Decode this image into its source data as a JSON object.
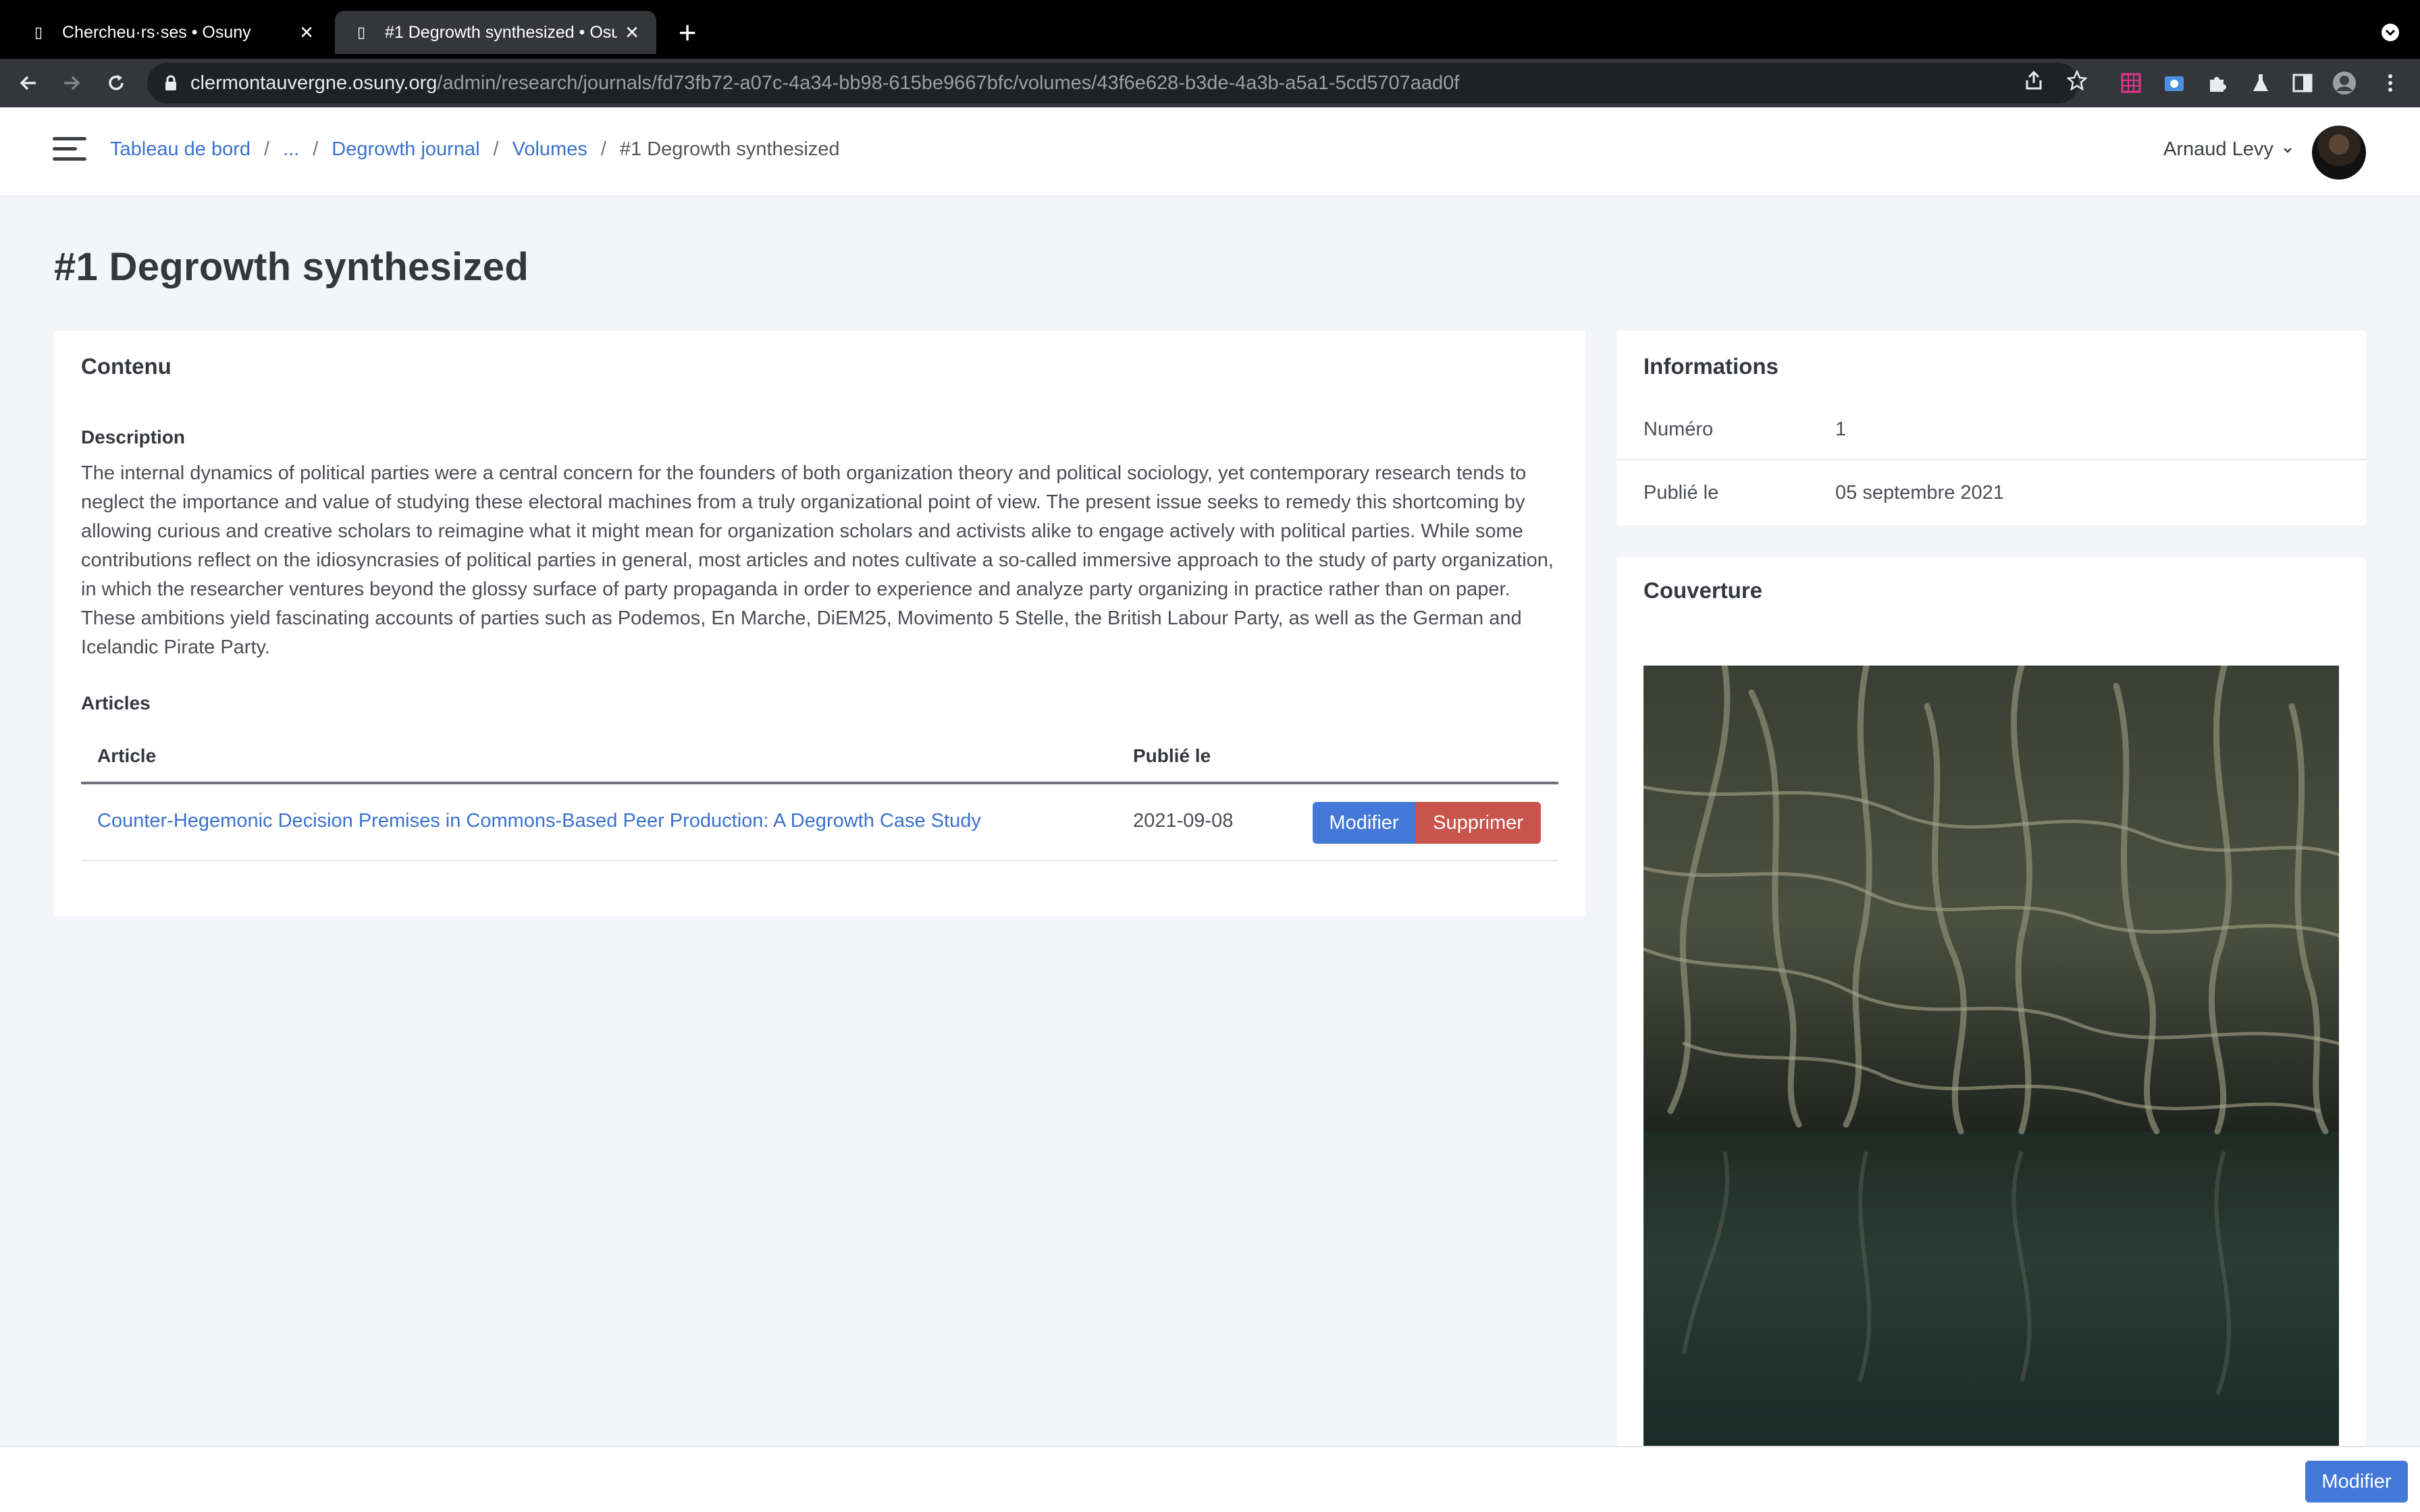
{
  "browser": {
    "tabs": [
      {
        "title": "Chercheu·rs·ses • Osuny",
        "active": false
      },
      {
        "title": "#1 Degrowth synthesized • Osuny",
        "active": true
      }
    ],
    "url_host": "clermontauvergne.osuny.org",
    "url_path": "/admin/research/journals/fd73fb72-a07c-4a34-bb98-615be9667bfc/volumes/43f6e628-b3de-4a3b-a5a1-5cd5707aad0f"
  },
  "header": {
    "breadcrumb": {
      "home": "Tableau de bord",
      "ellipsis": "...",
      "journal": "Degrowth journal",
      "volumes": "Volumes",
      "current": "#1 Degrowth synthesized"
    },
    "user_name": "Arnaud Levy"
  },
  "page": {
    "title": "#1 Degrowth synthesized"
  },
  "content": {
    "card_title": "Contenu",
    "description_label": "Description",
    "description": "The internal dynamics of political parties were a central concern for the founders of both organization theory and political sociology, yet contemporary research tends to neglect the importance and value of studying these electoral machines from a truly organizational point of view. The present issue seeks to remedy this shortcoming by allowing curious and creative scholars to reimagine what it might mean for organization scholars and activists alike to engage actively with political parties. While some contributions reflect on the idiosyncrasies of political parties in general, most articles and notes cultivate a so-called immersive approach to the study of party organization, in which the researcher ventures beyond the glossy surface of party propaganda in order to experience and analyze party organizing in practice rather than on paper. These ambitions yield fascinating accounts of parties such as Podemos, En Marche, DiEM25, Movimento 5 Stelle, the British Labour Party, as well as the German and Icelandic Pirate Party.",
    "articles_label": "Articles",
    "table": {
      "headers": {
        "article": "Article",
        "published": "Publié le"
      },
      "rows": [
        {
          "article": "Counter-Hegemonic Decision Premises in Commons-Based Peer Production: A Degrowth Case Study",
          "published": "2021-09-08",
          "edit_label": "Modifier",
          "delete_label": "Supprimer"
        }
      ]
    }
  },
  "info": {
    "card_title": "Informations",
    "number_label": "Numéro",
    "number_value": "1",
    "published_label": "Publié le",
    "published_value": "05 septembre 2021"
  },
  "cover": {
    "card_title": "Couverture"
  },
  "footer": {
    "edit_label": "Modifier"
  },
  "colors": {
    "link": "#3a71d0",
    "primary_button": "#4579d9",
    "danger_button": "#c9534d",
    "page_background": "#f4f5f9"
  }
}
